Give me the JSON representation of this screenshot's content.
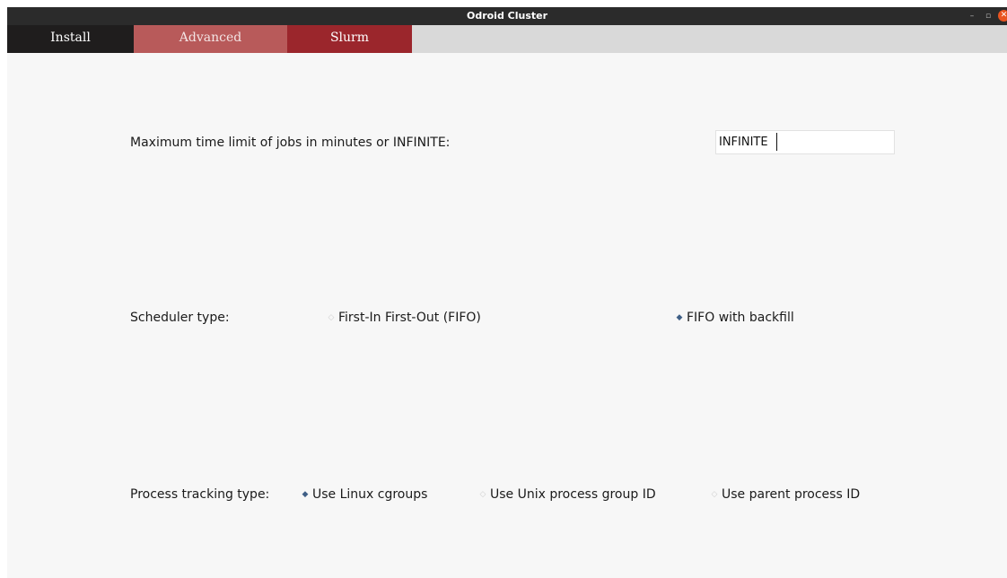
{
  "window": {
    "title": "Odroid Cluster",
    "controls": {
      "minimize": "–",
      "maximize": "▫",
      "close": "✕"
    }
  },
  "tabs": [
    {
      "label": "Install",
      "active": false
    },
    {
      "label": "Advanced",
      "active": false
    },
    {
      "label": "Slurm",
      "active": true
    }
  ],
  "time_limit": {
    "label": "Maximum time limit of jobs in minutes or INFINITE:",
    "value": "INFINITE"
  },
  "scheduler": {
    "label": "Scheduler type:",
    "options": [
      {
        "label": "First-In First-Out (FIFO)",
        "selected": false
      },
      {
        "label": "FIFO with backfill",
        "selected": true
      }
    ]
  },
  "process_tracking": {
    "label": "Process tracking type:",
    "options": [
      {
        "label": "Use Linux cgroups",
        "selected": true
      },
      {
        "label": "Use Unix process group ID",
        "selected": false
      },
      {
        "label": "Use parent process ID",
        "selected": false
      }
    ]
  },
  "colors": {
    "titlebar": "#2b2b2b",
    "tab_install": "#1f1d1d",
    "tab_advanced": "#b85a5a",
    "tab_slurm": "#9b262c",
    "radio_selected": "#3f5f86",
    "close_button": "#e95420"
  },
  "icons": {
    "radio_on": "◆",
    "radio_off": "◇"
  }
}
